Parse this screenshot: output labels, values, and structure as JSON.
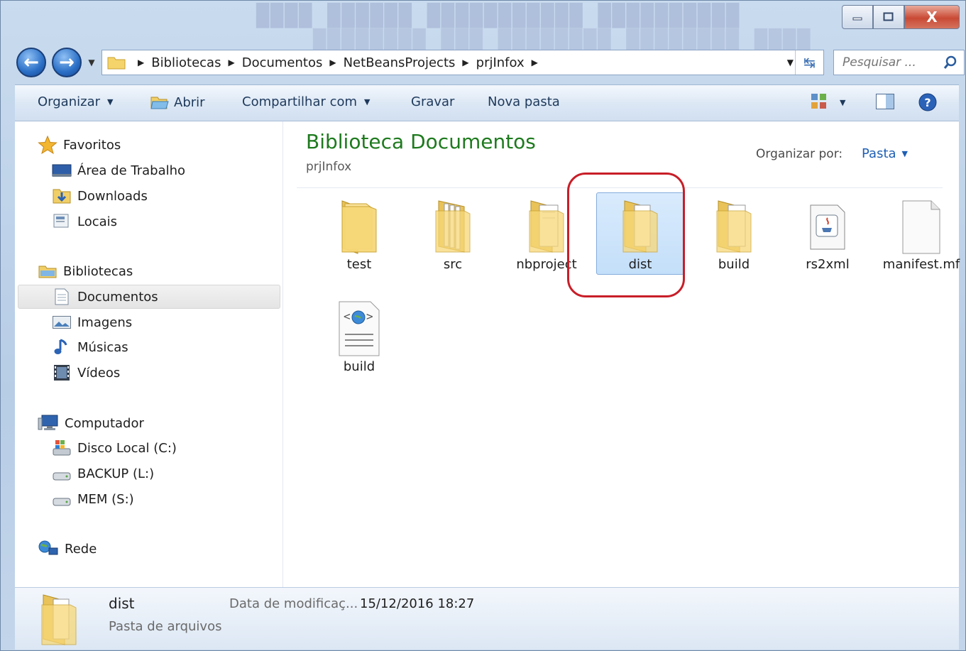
{
  "window": {
    "close_glyph": "X"
  },
  "address": {
    "crumbs": [
      "Bibliotecas",
      "Documentos",
      "NetBeansProjects",
      "prjInfox"
    ],
    "search_placeholder": "Pesquisar ..."
  },
  "toolbar": {
    "organize": "Organizar",
    "open": "Abrir",
    "share": "Compartilhar com",
    "burn": "Gravar",
    "new_folder": "Nova pasta"
  },
  "nav": {
    "favorites": "Favoritos",
    "desktop": "Área de Trabalho",
    "downloads": "Downloads",
    "places": "Locais",
    "libraries": "Bibliotecas",
    "documents": "Documentos",
    "images": "Imagens",
    "music": "Músicas",
    "videos": "Vídeos",
    "computer": "Computador",
    "disk_c": "Disco Local (C:)",
    "backup": "BACKUP (L:)",
    "mem": "MEM (S:)",
    "network": "Rede"
  },
  "main": {
    "title": "Biblioteca Documentos",
    "subtitle": "prjInfox",
    "arrange_label": "Organizar por:",
    "arrange_value": "Pasta",
    "files": [
      {
        "name": "test",
        "icon": "folder-icon"
      },
      {
        "name": "src",
        "icon": "folder-icon"
      },
      {
        "name": "nbproject",
        "icon": "folder-icon"
      },
      {
        "name": "dist",
        "icon": "folder-icon",
        "selected": true
      },
      {
        "name": "build",
        "icon": "folder-icon"
      },
      {
        "name": "rs2xml",
        "icon": "jar-file-icon"
      },
      {
        "name": "manifest.mf",
        "icon": "file-icon"
      },
      {
        "name": "build",
        "icon": "xml-file-icon"
      }
    ]
  },
  "details": {
    "name": "dist",
    "type": "Pasta de arquivos",
    "modified_label": "Data de modificaç...",
    "modified_value": "15/12/2016 18:27"
  },
  "colors": {
    "title_green": "#1e7a1e",
    "link_blue": "#1e5fb4",
    "highlight_red": "#c81e28"
  }
}
